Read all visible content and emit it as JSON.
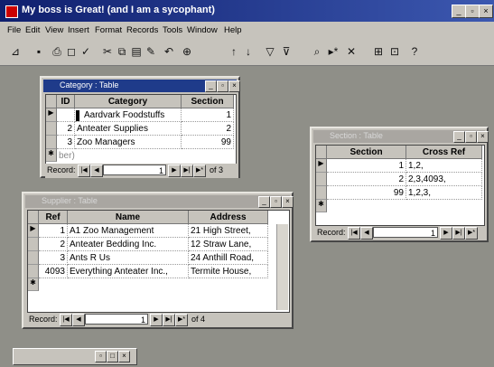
{
  "app": {
    "title": "My boss is Great! (and I am a sycophant)"
  },
  "menu": [
    "File",
    "Edit",
    "View",
    "Insert",
    "Format",
    "Records",
    "Tools",
    "Window",
    "Help"
  ],
  "toolbar_icons": [
    "design-view-icon",
    "save-icon",
    "print-icon",
    "print-preview-icon",
    "spelling-icon",
    "cut-icon",
    "copy-icon",
    "paste-icon",
    "format-painter-icon",
    "undo-icon",
    "hyperlink-icon",
    "sort-ascending-icon",
    "sort-descending-icon",
    "filter-icon",
    "find-icon",
    "new-record-icon",
    "delete-record-icon",
    "database-window-icon",
    "new-object-icon",
    "help-icon"
  ],
  "category_table": {
    "title": "Category : Table",
    "headers": [
      "ID",
      "Category",
      "Section"
    ],
    "rows": [
      {
        "id": "",
        "category": "Aardvark Foodstuffs",
        "section": "1"
      },
      {
        "id": "2",
        "category": "Anteater Supplies",
        "section": "2"
      },
      {
        "id": "3",
        "category": "Zoo Managers",
        "section": "99"
      }
    ],
    "new_row_id": "ber)",
    "nav": {
      "label": "Record:",
      "current": "1",
      "of_text": "of 3"
    }
  },
  "supplier_table": {
    "title": "Supplier : Table",
    "headers": [
      "Ref",
      "Name",
      "Address"
    ],
    "rows": [
      {
        "ref": "1",
        "name": "A1 Zoo Management",
        "address": "21 High Street,"
      },
      {
        "ref": "2",
        "name": "Anteater Bedding Inc.",
        "address": "12 Straw Lane,"
      },
      {
        "ref": "3",
        "name": "Ants R Us",
        "address": "24 Anthill Road,"
      },
      {
        "ref": "4093",
        "name": "Everything Anteater Inc.,",
        "address": "Termite House,"
      }
    ],
    "nav": {
      "label": "Record:",
      "current": "1",
      "of_text": "of 4"
    }
  },
  "section_table": {
    "title": "Section : Table",
    "headers": [
      "Section",
      "Cross Ref"
    ],
    "rows": [
      {
        "section": "1",
        "cross_ref": "1,2,"
      },
      {
        "section": "2",
        "cross_ref": "2,3,4093,"
      },
      {
        "section": "99",
        "cross_ref": "1,2,3,"
      }
    ],
    "nav": {
      "label": "Record:",
      "current": "1"
    }
  },
  "colors": {
    "title_active": "#1f3b8a",
    "title_inactive": "#a9a6a1",
    "face": "#c6c3bc",
    "mdi_bg": "#8f8f88"
  }
}
